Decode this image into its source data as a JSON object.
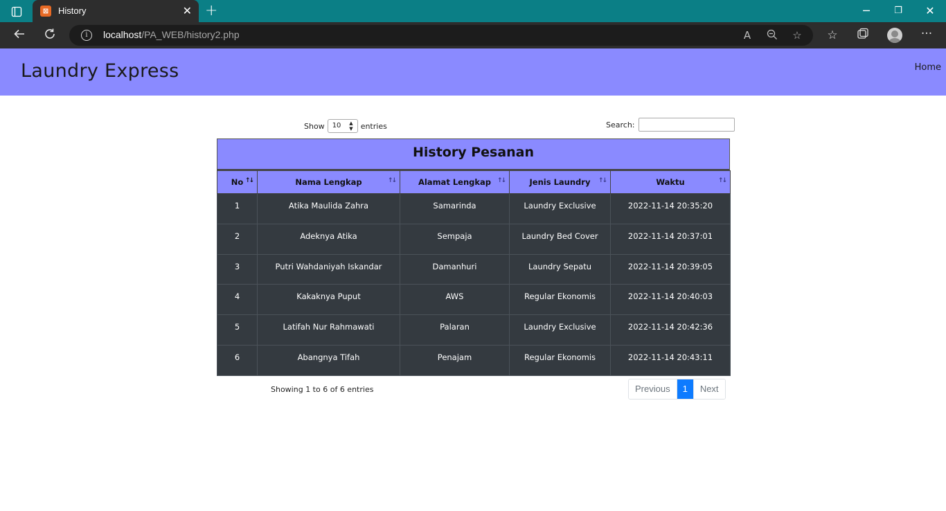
{
  "browser": {
    "tab_title": "History",
    "url_host": "localhost",
    "url_path": "/PA_WEB/history2.php"
  },
  "site": {
    "brand": "Laundry Express",
    "nav_home": "Home"
  },
  "controls": {
    "show_label": "Show",
    "entries_value": "10",
    "entries_label": "entries",
    "search_label": "Search:"
  },
  "table": {
    "title": "History Pesanan",
    "headers": [
      "No",
      "Nama Lengkap",
      "Alamat Lengkap",
      "Jenis Laundry",
      "Waktu"
    ],
    "rows": [
      [
        "1",
        "Atika Maulida Zahra",
        "Samarinda",
        "Laundry Exclusive",
        "2022-11-14 20:35:20"
      ],
      [
        "2",
        "Adeknya Atika",
        "Sempaja",
        "Laundry Bed Cover",
        "2022-11-14 20:37:01"
      ],
      [
        "3",
        "Putri Wahdaniyah Iskandar",
        "Damanhuri",
        "Laundry Sepatu",
        "2022-11-14 20:39:05"
      ],
      [
        "4",
        "Kakaknya Puput",
        "AWS",
        "Regular Ekonomis",
        "2022-11-14 20:40:03"
      ],
      [
        "5",
        "Latifah Nur Rahmawati",
        "Palaran",
        "Laundry Exclusive",
        "2022-11-14 20:42:36"
      ],
      [
        "6",
        "Abangnya Tifah",
        "Penajam",
        "Regular Ekonomis",
        "2022-11-14 20:43:11"
      ]
    ]
  },
  "footer": {
    "info": "Showing 1 to 6 of 6 entries",
    "previous": "Previous",
    "page": "1",
    "next": "Next"
  },
  "colors": {
    "accent": "#8a8aff",
    "table_body": "#343a40",
    "tabbar": "#0b7f86",
    "page_active": "#0d7bff"
  }
}
